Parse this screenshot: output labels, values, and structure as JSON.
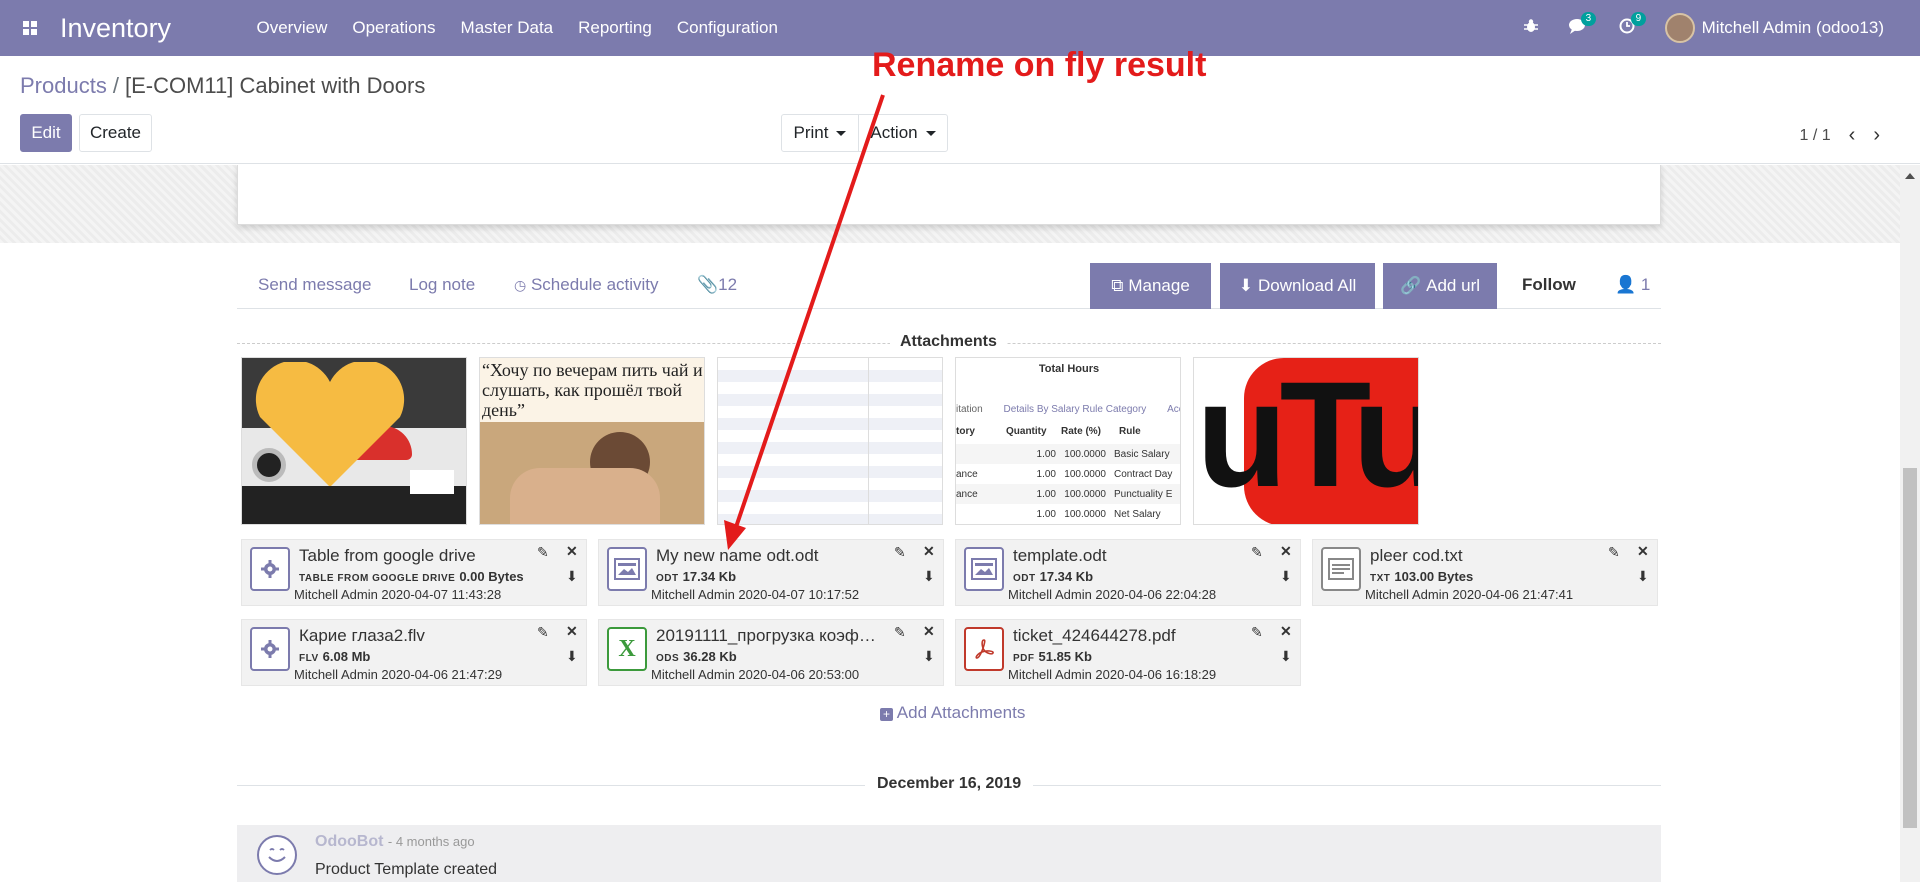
{
  "navbar": {
    "brand": "Inventory",
    "menu": [
      "Overview",
      "Operations",
      "Master Data",
      "Reporting",
      "Configuration"
    ],
    "messages_count": "3",
    "activities_count": "9",
    "user": "Mitchell Admin (odoo13)"
  },
  "control_panel": {
    "breadcrumb_root": "Products",
    "breadcrumb_sep": "/",
    "breadcrumb_current": "[E-COM11] Cabinet with Doors",
    "edit_label": "Edit",
    "create_label": "Create",
    "print_label": "Print",
    "action_label": "Action",
    "pager": "1 / 1"
  },
  "chatter": {
    "send_message": "Send message",
    "log_note": "Log note",
    "schedule_activity": "Schedule activity",
    "attachment_count": "12",
    "manage": "Manage",
    "download_all": "Download All",
    "add_url": "Add url",
    "follow": "Follow",
    "followers": "1",
    "attachments_title": "Attachments",
    "add_attachments": "Add Attachments",
    "date_separator": "December 16, 2019"
  },
  "thumbnails": {
    "t2_text": "“Хочу по вечерам пить чай и слушать, как прошёл твой день”",
    "t4_title": "Total Hours",
    "t4_tab1": "itation",
    "t4_tab2": "Details By Salary Rule Category",
    "t4_tab3": "Acc",
    "t4_cols": [
      "tory",
      "Quantity",
      "Rate (%)",
      "Rule"
    ],
    "t4_rows": [
      [
        "",
        "1.00",
        "100.0000",
        "Basic Salary"
      ],
      [
        "ance",
        "1.00",
        "100.0000",
        "Contract Day"
      ],
      [
        "ance",
        "1.00",
        "100.0000",
        "Punctuality E"
      ],
      [
        "",
        "1.00",
        "100.0000",
        "Net Salary"
      ]
    ],
    "t5_text": "uTub"
  },
  "attachments": [
    {
      "name": "Table from google drive",
      "ext": "TABLE FROM GOOGLE DRIVE",
      "size": "0.00 Bytes",
      "by": "Mitchell Admin 2020-04-07 11:43:28",
      "icon": "gear-icon"
    },
    {
      "name": "My new name odt.odt",
      "ext": "ODT",
      "size": "17.34 Kb",
      "by": "Mitchell Admin 2020-04-07 10:17:52",
      "icon": "image-file-icon"
    },
    {
      "name": "template.odt",
      "ext": "ODT",
      "size": "17.34 Kb",
      "by": "Mitchell Admin 2020-04-06 22:04:28",
      "icon": "image-file-icon"
    },
    {
      "name": "pleer cod.txt",
      "ext": "TXT",
      "size": "103.00 Bytes",
      "by": "Mitchell Admin 2020-04-06 21:47:41",
      "icon": "text-file-icon"
    },
    {
      "name": "Карие глаза2.flv",
      "ext": "FLV",
      "size": "6.08 Mb",
      "by": "Mitchell Admin 2020-04-06 21:47:29",
      "icon": "gear-icon"
    },
    {
      "name": "20191111_прогрузка коэфф…",
      "ext": "ODS",
      "size": "36.28 Kb",
      "by": "Mitchell Admin 2020-04-06 20:53:00",
      "icon": "spreadsheet-icon"
    },
    {
      "name": "ticket_424644278.pdf",
      "ext": "PDF",
      "size": "51.85 Kb",
      "by": "Mitchell Admin 2020-04-06 16:18:29",
      "icon": "pdf-icon"
    }
  ],
  "message": {
    "author": "OdooBot",
    "date": "- 4 months ago",
    "body": "Product Template created"
  },
  "annotation": {
    "text": "Rename on fly result",
    "color": "#e31b1b"
  },
  "colors": {
    "primary": "#7c7bad",
    "teal_badge": "#00a09d"
  }
}
